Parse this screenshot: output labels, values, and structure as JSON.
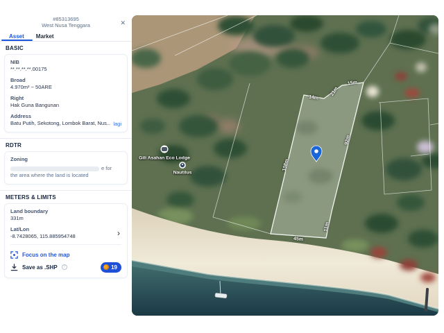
{
  "panel": {
    "id": "#85313695",
    "region": "West Nusa Tenggara",
    "close_icon": "✕",
    "tabs": {
      "asset": "Asset",
      "market": "Market"
    },
    "basic": {
      "title": "BASIC",
      "nib_label": "NIB",
      "nib_value": "**.**.**.**.00175",
      "broad_label": "Broad",
      "broad_value": "4.970m² ~ 50ARE",
      "right_label": "Right",
      "right_value": "Hak Guna Bangunan",
      "address_label": "Address",
      "address_value": "Batu Putih, Sekotong, Lombok Barat, Nus...",
      "address_more_link": "lagi"
    },
    "rdtr": {
      "title": "RDTR",
      "zoning_label": "Zoning",
      "zoning_masked_suffix": "e for",
      "zoning_line2": "the area where the land is located"
    },
    "meters": {
      "title": "METERS & LIMITS",
      "land_boundary_label": "Land boundary",
      "land_boundary_value": "331m",
      "latlon_label": "Lat/Lon",
      "latlon_value": "-8.7428065, 115.885954748",
      "focus_label": "Focus on the map",
      "save_label": "Save as .SHP",
      "badge_count": "19"
    }
  },
  "map": {
    "poi": {
      "lodge_label": "Gili Asahan Eco Lodge",
      "nautilus_label": "Nautilus"
    },
    "measurements": {
      "top1": "14m",
      "diag": "21m",
      "top2": "15m",
      "right": "92m",
      "left": "108m",
      "right_short": "11m",
      "bottom": "45m"
    },
    "colors": {
      "pin": "#1a66d9",
      "parcel_stroke": "#f3f6f0",
      "accent_blue": "#1a56db",
      "badge_blue": "#1d4fd7",
      "coin_orange": "#f5a623"
    }
  }
}
